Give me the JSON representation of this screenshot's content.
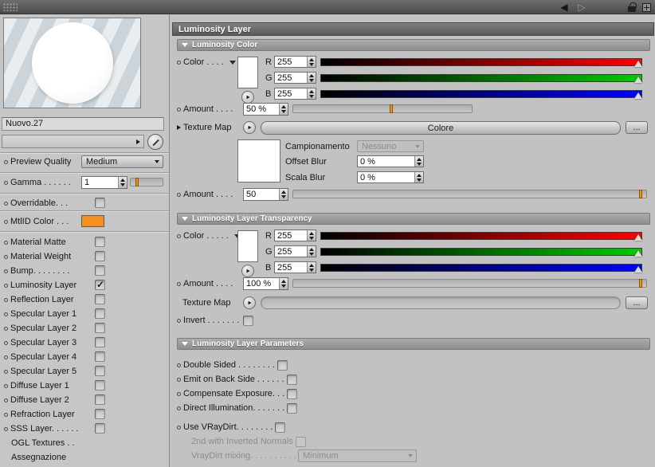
{
  "titlebar": {
    "icons": {
      "grip": "grip-dots",
      "back": "◀",
      "forward": "▷",
      "lock": "lock-shape",
      "add": "+"
    }
  },
  "left": {
    "material_name": "Nuovo.27",
    "preview_quality": {
      "label": "Preview Quality",
      "value": "Medium"
    },
    "gamma": {
      "label": "Gamma . . . . . .",
      "value": "1",
      "marker_percent": 15
    },
    "overridable": {
      "label": "Overridable. . ."
    },
    "mtlid": {
      "label": "MtlID Color . . .",
      "color": "#f78f1e"
    },
    "channels": [
      {
        "label": "Material Matte",
        "checked": false
      },
      {
        "label": "Material Weight",
        "checked": false
      },
      {
        "label": "Bump. . . . . . . .",
        "checked": false
      },
      {
        "label": "Luminosity Layer",
        "checked": true
      },
      {
        "label": "Reflection Layer",
        "checked": false
      },
      {
        "label": "Specular Layer 1",
        "checked": false
      },
      {
        "label": "Specular Layer 2",
        "checked": false
      },
      {
        "label": "Specular Layer 3",
        "checked": false
      },
      {
        "label": "Specular Layer 4",
        "checked": false
      },
      {
        "label": "Specular Layer 5",
        "checked": false
      },
      {
        "label": "Diffuse Layer 1",
        "checked": false
      },
      {
        "label": "Diffuse Layer 2",
        "checked": false
      },
      {
        "label": "Refraction Layer",
        "checked": false
      },
      {
        "label": "SSS Layer. . . . . .",
        "checked": false
      }
    ],
    "ogl_textures_label": "OGL Textures . .",
    "assegnazione_label": "Assegnazione"
  },
  "main": {
    "title": "Luminosity Layer",
    "luminosity_color": {
      "header": "Luminosity Color",
      "color_label": "Color . . . .",
      "rgb": {
        "r_label": "R",
        "r_value": "255",
        "g_label": "G",
        "g_value": "255",
        "b_label": "B",
        "b_value": "255"
      },
      "amount_color": {
        "label": "Amount . . . .",
        "value": "50 %",
        "marker_percent": 54
      },
      "texture_map": {
        "label": "Texture Map",
        "button_label": "Colore",
        "browse_label": "..."
      },
      "campionamento": {
        "label": "Campionamento",
        "value": "Nessuno"
      },
      "offset_blur": {
        "label": "Offset Blur",
        "value": "0 %"
      },
      "scala_blur": {
        "label": "Scala Blur",
        "value": "0 %"
      },
      "amount_texture": {
        "label": "Amount . . . .",
        "value": "50",
        "marker_percent": 98
      }
    },
    "transparency": {
      "header": "Luminosity Layer Transparency",
      "color_label": "Color . . . . .",
      "rgb": {
        "r_label": "R",
        "r_value": "255",
        "g_label": "G",
        "g_value": "255",
        "b_label": "B",
        "b_value": "255"
      },
      "amount": {
        "label": "Amount . . . .",
        "value": "100 %",
        "marker_percent": 98
      },
      "texture_map": {
        "label": "Texture Map",
        "browse_label": "..."
      },
      "invert_label": "Invert . . . . . . ."
    },
    "parameters": {
      "header": "Luminosity Layer Parameters",
      "double_sided": "Double Sided . . . . . . . .",
      "emit_back": "Emit on Back Side . . . . . .",
      "compensate": "Compensate Exposure. . .",
      "direct_illum": "Direct Illumination. . . . . . .",
      "use_vraydirt": "Use VRayDirt. . . . . . . .",
      "inverted_normals": "2nd with Inverted Normals",
      "vraydirt_mixing": {
        "label": "VrayDirt mixing. . . . . . . . . .",
        "value": "Minimum"
      }
    }
  },
  "colors": {
    "accent_orange": "#f78f1e",
    "slider_red": "#ff0000",
    "slider_green": "#00cc00",
    "slider_blue": "#0000ff"
  }
}
